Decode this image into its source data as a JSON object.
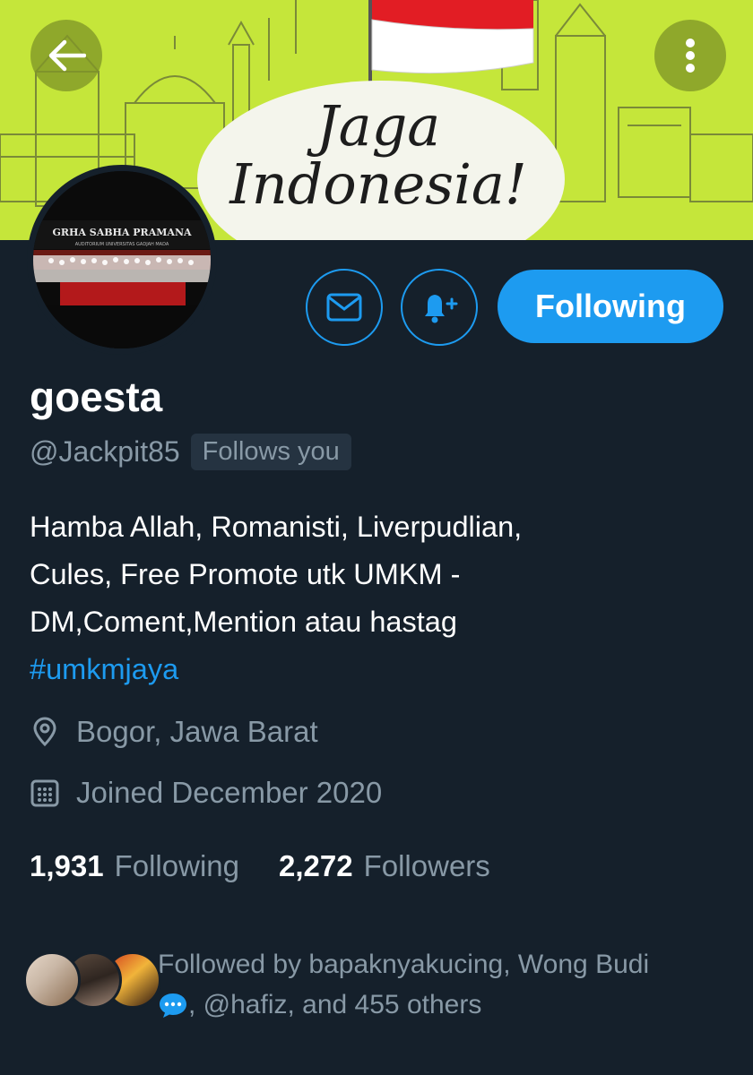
{
  "banner": {
    "line1": "Jaga",
    "line2": "Indonesia!"
  },
  "actions": {
    "following_label": "Following"
  },
  "profile": {
    "display_name": "goesta",
    "handle": "@Jackpit85",
    "follows_you": "Follows you",
    "bio_lines": [
      "Hamba Allah, Romanisti, Liverpudlian,",
      "Cules,  Free Promote utk UMKM -",
      "DM,Coment,Mention atau hastag"
    ],
    "bio_hashtag": "#umkmjaya",
    "location": "Bogor, Jawa Barat",
    "joined": "Joined December 2020"
  },
  "stats": {
    "following_count": "1,931",
    "following_label": "Following",
    "followers_count": "2,272",
    "followers_label": "Followers"
  },
  "followed_by": {
    "line1": "Followed by bapaknyakucing, Wong Budi",
    "line2": ", @hafiz, and 455 others"
  },
  "avatar_text": {
    "top": "GRHA SABHA PRAMANA",
    "sub": "AUDITORIUM UNIVERSITAS GADJAH MADA"
  },
  "colors": {
    "background": "#15202b",
    "accent": "#1d9bf0",
    "muted": "#8899a6",
    "banner": "#c5e63a"
  }
}
